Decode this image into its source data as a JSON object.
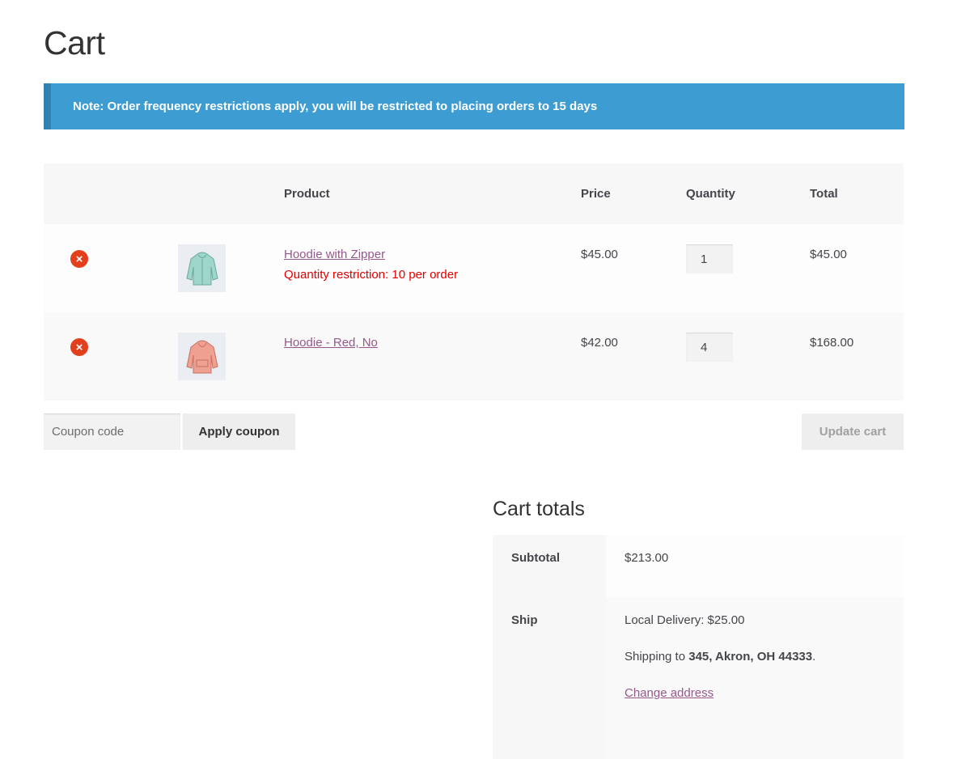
{
  "page": {
    "title": "Cart"
  },
  "notice": {
    "text": "Note: Order frequency restrictions apply, you will be restricted to placing orders to 15 days"
  },
  "table": {
    "headers": {
      "product": "Product",
      "price": "Price",
      "quantity": "Quantity",
      "total": "Total"
    },
    "rows": [
      {
        "name": "Hoodie with Zipper",
        "restriction": "Quantity restriction: 10 per order",
        "price": "$45.00",
        "qty": "1",
        "total": "$45.00",
        "color": "#9ed6cc"
      },
      {
        "name": "Hoodie - Red, No",
        "restriction": "",
        "price": "$42.00",
        "qty": "4",
        "total": "$168.00",
        "color": "#f0a091"
      }
    ]
  },
  "actions": {
    "coupon_placeholder": "Coupon code",
    "apply_label": "Apply coupon",
    "update_label": "Update cart"
  },
  "totals": {
    "title": "Cart totals",
    "subtotal_label": "Subtotal",
    "subtotal_value": "$213.00",
    "ship_label": "Ship",
    "delivery": "Local Delivery: $25.00",
    "shipping_prefix": "Shipping to ",
    "shipping_address": "345, Akron, OH 44333",
    "shipping_suffix": ".",
    "change_address": "Change address"
  },
  "colors": {
    "notice_bg": "#3d9cd2",
    "link": "#96588a",
    "remove": "#e2401c",
    "restriction": "#e20000"
  },
  "icons": {
    "remove": "remove-x-icon",
    "hoodie": "hoodie-icon"
  }
}
